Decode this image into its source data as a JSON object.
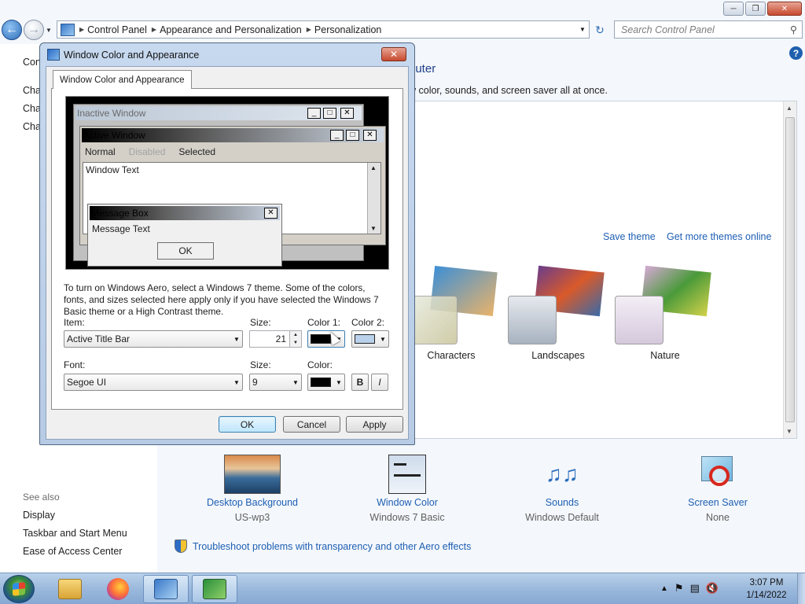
{
  "control_panel": {
    "breadcrumb": [
      "Control Panel",
      "Appearance and Personalization",
      "Personalization"
    ],
    "search_placeholder": "Search Control Panel",
    "title_fragment": "puter",
    "subtitle_fragment": "w color, sounds, and screen saver all at once.",
    "left_nav": {
      "partial_top": "Con",
      "partial_items": [
        "Cha",
        "Cha",
        "Cha"
      ],
      "see_also_heading": "See also",
      "see_also": [
        "Display",
        "Taskbar and Start Menu",
        "Ease of Access Center"
      ]
    },
    "theme_links": {
      "save": "Save theme",
      "more": "Get more themes online"
    },
    "themes": [
      "Characters",
      "Landscapes",
      "Nature"
    ],
    "bottom_items": [
      {
        "label": "Desktop Background",
        "value": "US-wp3",
        "icon": "desktop-background-icon"
      },
      {
        "label": "Window Color",
        "value": "Windows 7 Basic",
        "icon": "window-color-icon"
      },
      {
        "label": "Sounds",
        "value": "Windows Default",
        "icon": "sounds-icon"
      },
      {
        "label": "Screen Saver",
        "value": "None",
        "icon": "screen-saver-icon"
      }
    ],
    "troubleshoot_link": "Troubleshoot problems with transparency and other Aero effects"
  },
  "dialog": {
    "title": "Window Color and Appearance",
    "tab": "Window Color and Appearance",
    "preview": {
      "inactive_title": "Inactive Window",
      "active_title": "Active Window",
      "menu": [
        "Normal",
        "Disabled",
        "Selected"
      ],
      "window_text": "Window Text",
      "message_box_title": "Message Box",
      "message_text": "Message Text",
      "ok": "OK"
    },
    "description": "To turn on Windows Aero, select a Windows 7 theme.  Some of the colors, fonts, and sizes selected here apply only if you have selected the Windows 7 Basic theme or a High Contrast theme.",
    "labels": {
      "item": "Item:",
      "size": "Size:",
      "color1": "Color 1:",
      "color2": "Color 2:",
      "font": "Font:",
      "font_size": "Size:",
      "color": "Color:"
    },
    "item_value": "Active Title Bar",
    "item_size": "21",
    "color1": "#000000",
    "color2": "#b9d1ea",
    "font_value": "Segoe UI",
    "font_size_value": "9",
    "font_color": "#000000",
    "bold": "B",
    "italic": "I",
    "buttons": {
      "ok": "OK",
      "cancel": "Cancel",
      "apply": "Apply"
    }
  },
  "taskbar": {
    "time": "3:07 PM",
    "date": "1/14/2022"
  }
}
